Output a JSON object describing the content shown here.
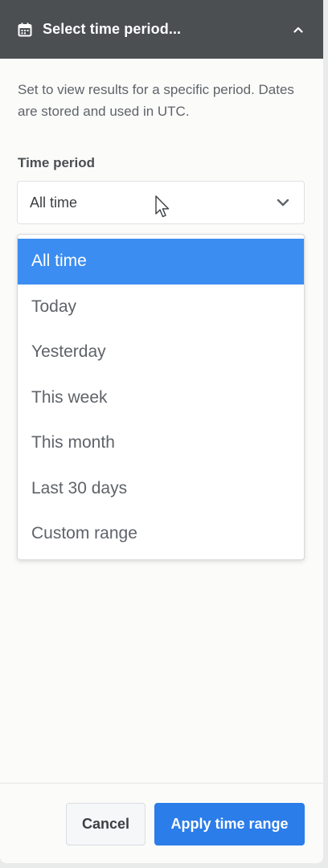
{
  "header": {
    "title": "Select time period...",
    "icon": "calendar-icon",
    "toggle_icon": "chevron-up-icon"
  },
  "description": "Set to view results for a specific period. Dates are stored and used in UTC.",
  "time_period": {
    "label": "Time period",
    "selected": "All time",
    "options": [
      "All time",
      "Today",
      "Yesterday",
      "This week",
      "This month",
      "Last 30 days",
      "Custom range"
    ]
  },
  "footer": {
    "cancel_label": "Cancel",
    "apply_label": "Apply time range"
  },
  "colors": {
    "header_bg": "#4b4f52",
    "selected_option": "#3c8df1",
    "primary_button": "#2b7de9"
  }
}
